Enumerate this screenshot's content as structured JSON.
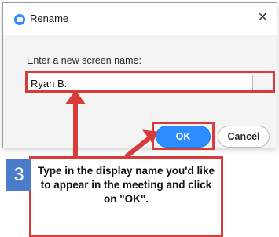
{
  "dialog": {
    "title": "Rename",
    "close_glyph": "×",
    "icon": "zoom-app-icon",
    "prompt": "Enter a new screen name:",
    "name_value": "Ryan B.",
    "ok_label": "OK",
    "cancel_label": "Cancel"
  },
  "annotation": {
    "step_number": "3",
    "instruction": "Type in the display name you'd like to appear in the meeting and click on \"OK\".",
    "highlight_color": "#d93a3a"
  },
  "colors": {
    "primary_button": "#2d8cff",
    "step_badge": "#4a7cc9"
  }
}
